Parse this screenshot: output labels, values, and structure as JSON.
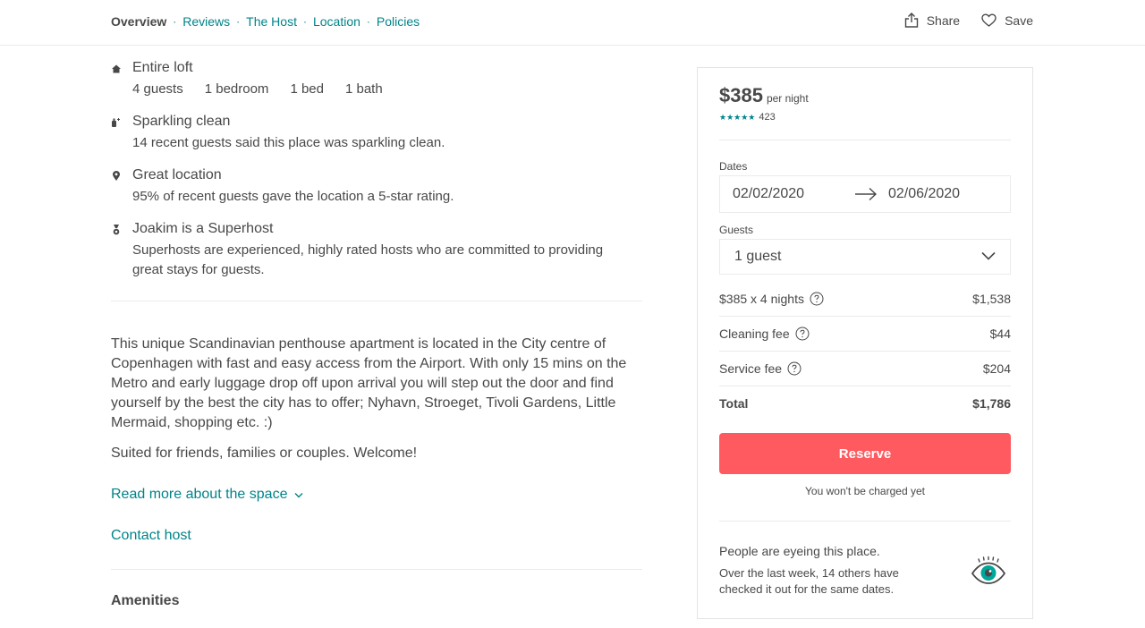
{
  "nav": {
    "tabs": [
      {
        "label": "Overview"
      },
      {
        "label": "Reviews"
      },
      {
        "label": "The Host"
      },
      {
        "label": "Location"
      },
      {
        "label": "Policies"
      }
    ],
    "separator": "·",
    "share_label": "Share",
    "save_label": "Save"
  },
  "highlights": {
    "loft": {
      "title": "Entire loft",
      "icon": "home-icon",
      "specs": [
        "4 guests",
        "1 bedroom",
        "1 bed",
        "1 bath"
      ]
    },
    "clean": {
      "title": "Sparkling clean",
      "icon": "sparkle-icon",
      "desc": "14 recent guests said this place was sparkling clean."
    },
    "location": {
      "title": "Great location",
      "icon": "map-pin-icon",
      "desc": "95% of recent guests gave the location a 5-star rating."
    },
    "superhost": {
      "title": "Joakim is a Superhost",
      "icon": "medal-icon",
      "desc": "Superhosts are experienced, highly rated hosts who are committed to providing great stays for guests."
    }
  },
  "description": {
    "paragraph": "This unique Scandinavian penthouse apartment is located in the City centre of Copenhagen with fast and easy access from the Airport. With only 15 mins on the Metro and early luggage drop off upon arrival you will step out the door and find yourself by the best the city has to offer; Nyhavn, Stroeget, Tivoli Gardens, Little Mermaid, shopping etc. :)",
    "welcome": "Suited for friends, families or couples. Welcome!",
    "read_more": "Read more about the space",
    "contact_host": "Contact host"
  },
  "amenities_heading": "Amenities",
  "booking": {
    "price": "$385",
    "price_unit": "per night",
    "stars": "★★★★★",
    "rating": 5,
    "review_count": "423",
    "dates_label": "Dates",
    "check_in": "02/02/2020",
    "check_out": "02/06/2020",
    "guests_label": "Guests",
    "guests_value": "1 guest",
    "lines": [
      {
        "label": "$385 x 4 nights",
        "amount": "$1,538"
      },
      {
        "label": "Cleaning fee",
        "amount": "$44"
      },
      {
        "label": "Service fee",
        "amount": "$204"
      }
    ],
    "total_label": "Total",
    "total_amount": "$1,786",
    "reserve_label": "Reserve",
    "not_charged": "You won't be charged yet",
    "eyeing_title": "People are eyeing this place.",
    "eyeing_desc": "Over the last week, 14 others have checked it out for the same dates."
  },
  "colors": {
    "accent_teal": "#008489",
    "reserve_red": "#ff5a5f",
    "text": "#484848",
    "border": "#ebebeb"
  }
}
